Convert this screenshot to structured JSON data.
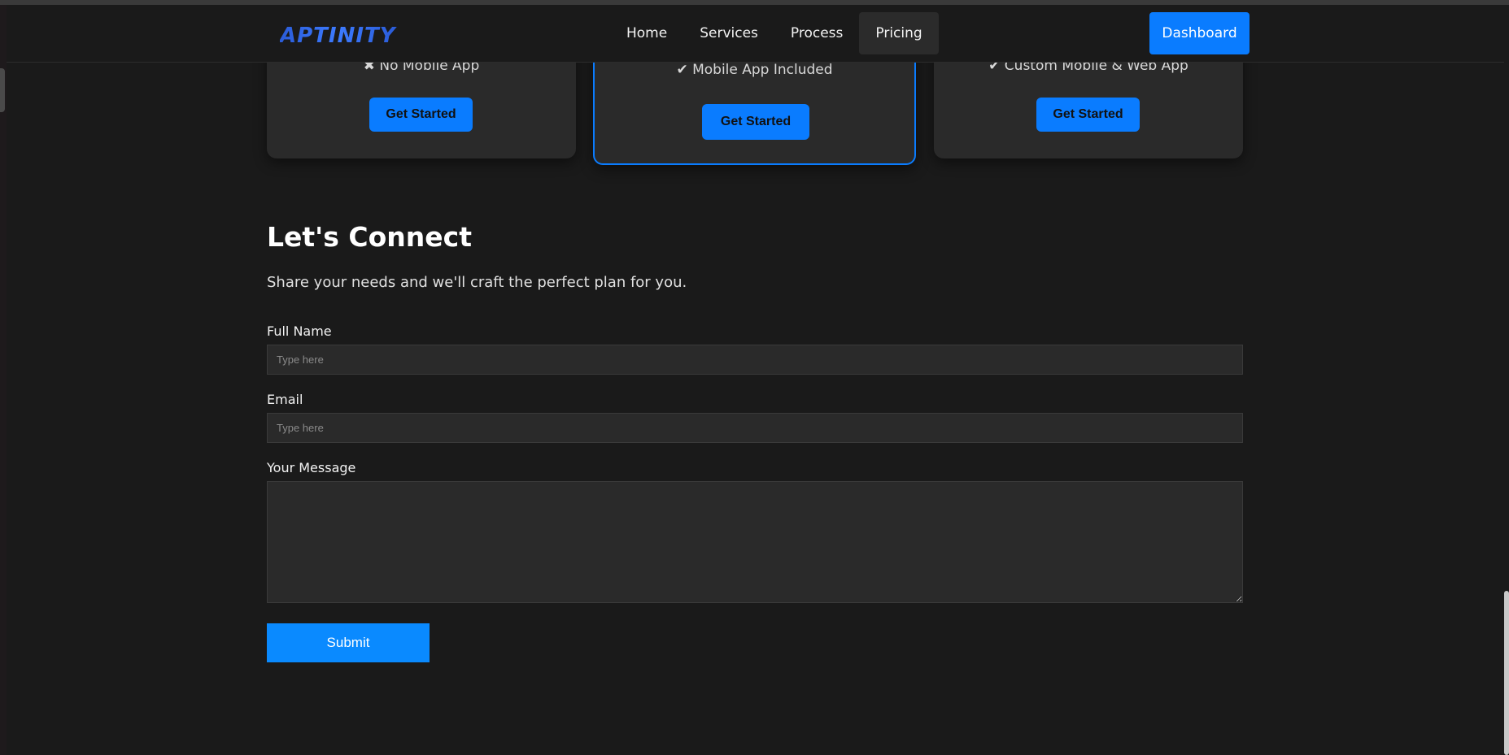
{
  "brand": {
    "logo_text": "APTINITY"
  },
  "nav": {
    "links": [
      "Home",
      "Services",
      "Process",
      "Pricing"
    ],
    "active": "Pricing",
    "dashboard_label": "Dashboard"
  },
  "pricing": {
    "cards": [
      {
        "feature": "✖ No Mobile App",
        "button": "Get Started"
      },
      {
        "feature": "✔ Mobile App Included",
        "button": "Get Started",
        "featured": true
      },
      {
        "feature": "✔ Custom Mobile & Web App",
        "button": "Get Started"
      }
    ]
  },
  "contact": {
    "title": "Let's Connect",
    "subtitle": "Share your needs and we'll craft the perfect plan for you.",
    "name_label": "Full Name",
    "name_placeholder": "Type here",
    "email_label": "Email",
    "email_placeholder": "Type here",
    "message_label": "Your Message",
    "submit_label": "Submit"
  },
  "colors": {
    "accent": "#0a7cff",
    "background": "#1a1a1a",
    "card": "#2a2a2a"
  }
}
